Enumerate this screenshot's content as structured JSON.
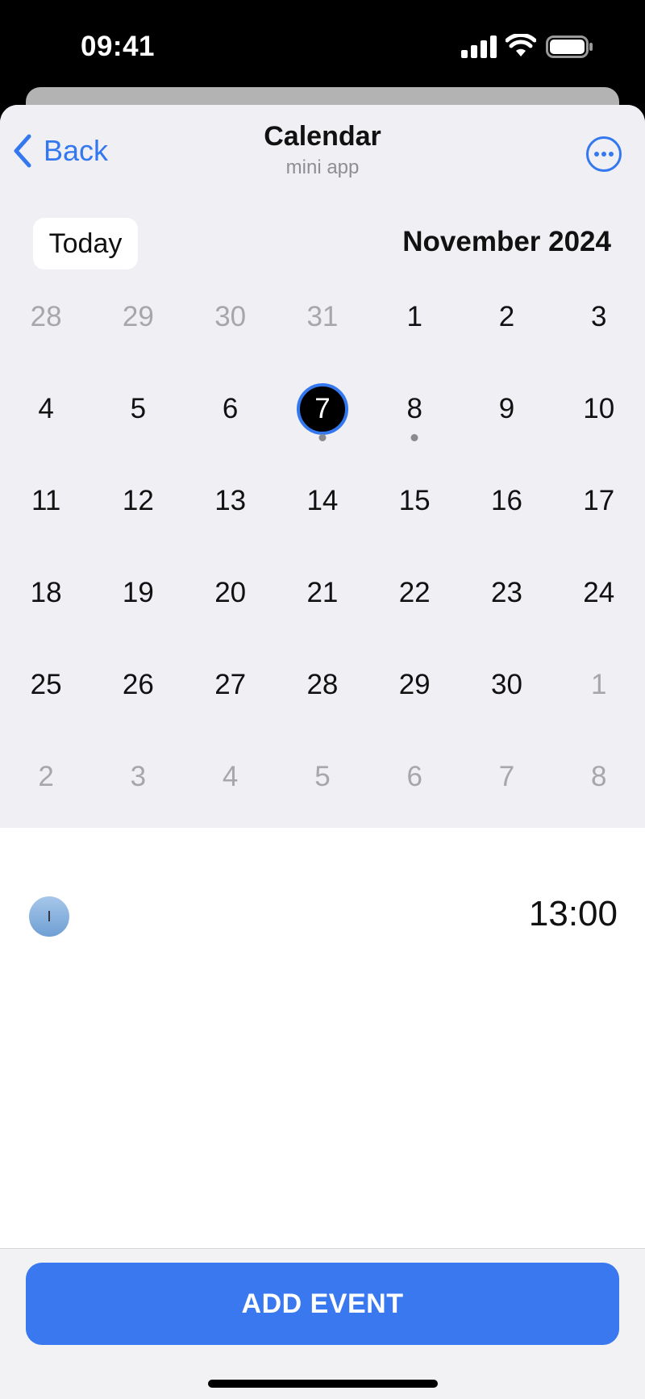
{
  "status_bar": {
    "time": "09:41",
    "signal_icon": "cellular-signal-icon",
    "wifi_icon": "wifi-icon",
    "battery_icon": "battery-icon"
  },
  "header": {
    "back_label": "Back",
    "title": "Calendar",
    "subtitle": "mini app",
    "more_icon": "ellipsis-circle-icon"
  },
  "calendar": {
    "today_label": "Today",
    "month_label": "November 2024",
    "selected_day": "7",
    "days": [
      {
        "label": "28",
        "current": false
      },
      {
        "label": "29",
        "current": false
      },
      {
        "label": "30",
        "current": false
      },
      {
        "label": "31",
        "current": false
      },
      {
        "label": "1",
        "current": true
      },
      {
        "label": "2",
        "current": true
      },
      {
        "label": "3",
        "current": true
      },
      {
        "label": "4",
        "current": true
      },
      {
        "label": "5",
        "current": true
      },
      {
        "label": "6",
        "current": true
      },
      {
        "label": "7",
        "current": true,
        "selected": true,
        "has_event": true
      },
      {
        "label": "8",
        "current": true,
        "has_event": true
      },
      {
        "label": "9",
        "current": true
      },
      {
        "label": "10",
        "current": true
      },
      {
        "label": "11",
        "current": true
      },
      {
        "label": "12",
        "current": true
      },
      {
        "label": "13",
        "current": true
      },
      {
        "label": "14",
        "current": true
      },
      {
        "label": "15",
        "current": true
      },
      {
        "label": "16",
        "current": true
      },
      {
        "label": "17",
        "current": true
      },
      {
        "label": "18",
        "current": true
      },
      {
        "label": "19",
        "current": true
      },
      {
        "label": "20",
        "current": true
      },
      {
        "label": "21",
        "current": true
      },
      {
        "label": "22",
        "current": true
      },
      {
        "label": "23",
        "current": true
      },
      {
        "label": "24",
        "current": true
      },
      {
        "label": "25",
        "current": true
      },
      {
        "label": "26",
        "current": true
      },
      {
        "label": "27",
        "current": true
      },
      {
        "label": "28",
        "current": true
      },
      {
        "label": "29",
        "current": true
      },
      {
        "label": "30",
        "current": true
      },
      {
        "label": "1",
        "current": false
      },
      {
        "label": "2",
        "current": false
      },
      {
        "label": "3",
        "current": false
      },
      {
        "label": "4",
        "current": false
      },
      {
        "label": "5",
        "current": false
      },
      {
        "label": "6",
        "current": false
      },
      {
        "label": "7",
        "current": false
      },
      {
        "label": "8",
        "current": false
      }
    ]
  },
  "events": [
    {
      "avatar_initial": "I",
      "time": "13:00"
    }
  ],
  "actions": {
    "add_event_label": "ADD EVENT"
  },
  "colors": {
    "accent": "#3478f0",
    "button": "#3a78ef",
    "calendar_bg": "#efeff4",
    "muted_day": "#a6a6ab"
  }
}
